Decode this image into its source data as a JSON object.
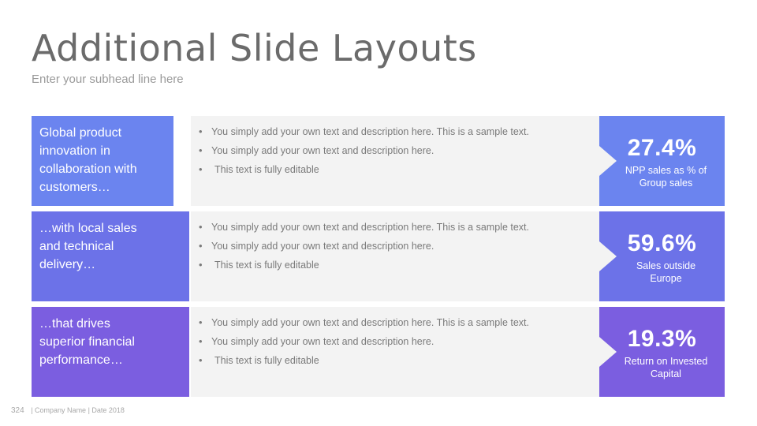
{
  "slide": {
    "title": "Additional Slide Layouts",
    "subhead": "Enter your subhead line here"
  },
  "rows": [
    {
      "left_text": "Global product innovation in collaboration with customers…",
      "bullets": [
        "You simply add your own text and description here. This is a sample text.",
        "You simply add your own text and description here.",
        "This text is fully editable"
      ],
      "stat": "27.4%",
      "stat_desc": "NPP sales as % of Group sales"
    },
    {
      "left_text": "…with local sales and technical delivery…",
      "bullets": [
        "You simply add your own text and description here. This is a sample text.",
        "You simply add your own text and description here.",
        "This text is fully editable"
      ],
      "stat": "59.6%",
      "stat_desc": "Sales outside Europe"
    },
    {
      "left_text": "…that drives superior financial performance…",
      "bullets": [
        "You simply add your own text and description here. This is a sample text.",
        "You simply add your own text and description here.",
        "This text is fully editable"
      ],
      "stat": "19.3%",
      "stat_desc": "Return on Invested Capital"
    }
  ],
  "footer": {
    "page_number": "324",
    "text": "| Company Name | Date 2018"
  },
  "colors": {
    "row1": "#6b84ef",
    "row2": "#6c72e8",
    "row3": "#7b5ee0",
    "panel": "#f3f3f3"
  }
}
